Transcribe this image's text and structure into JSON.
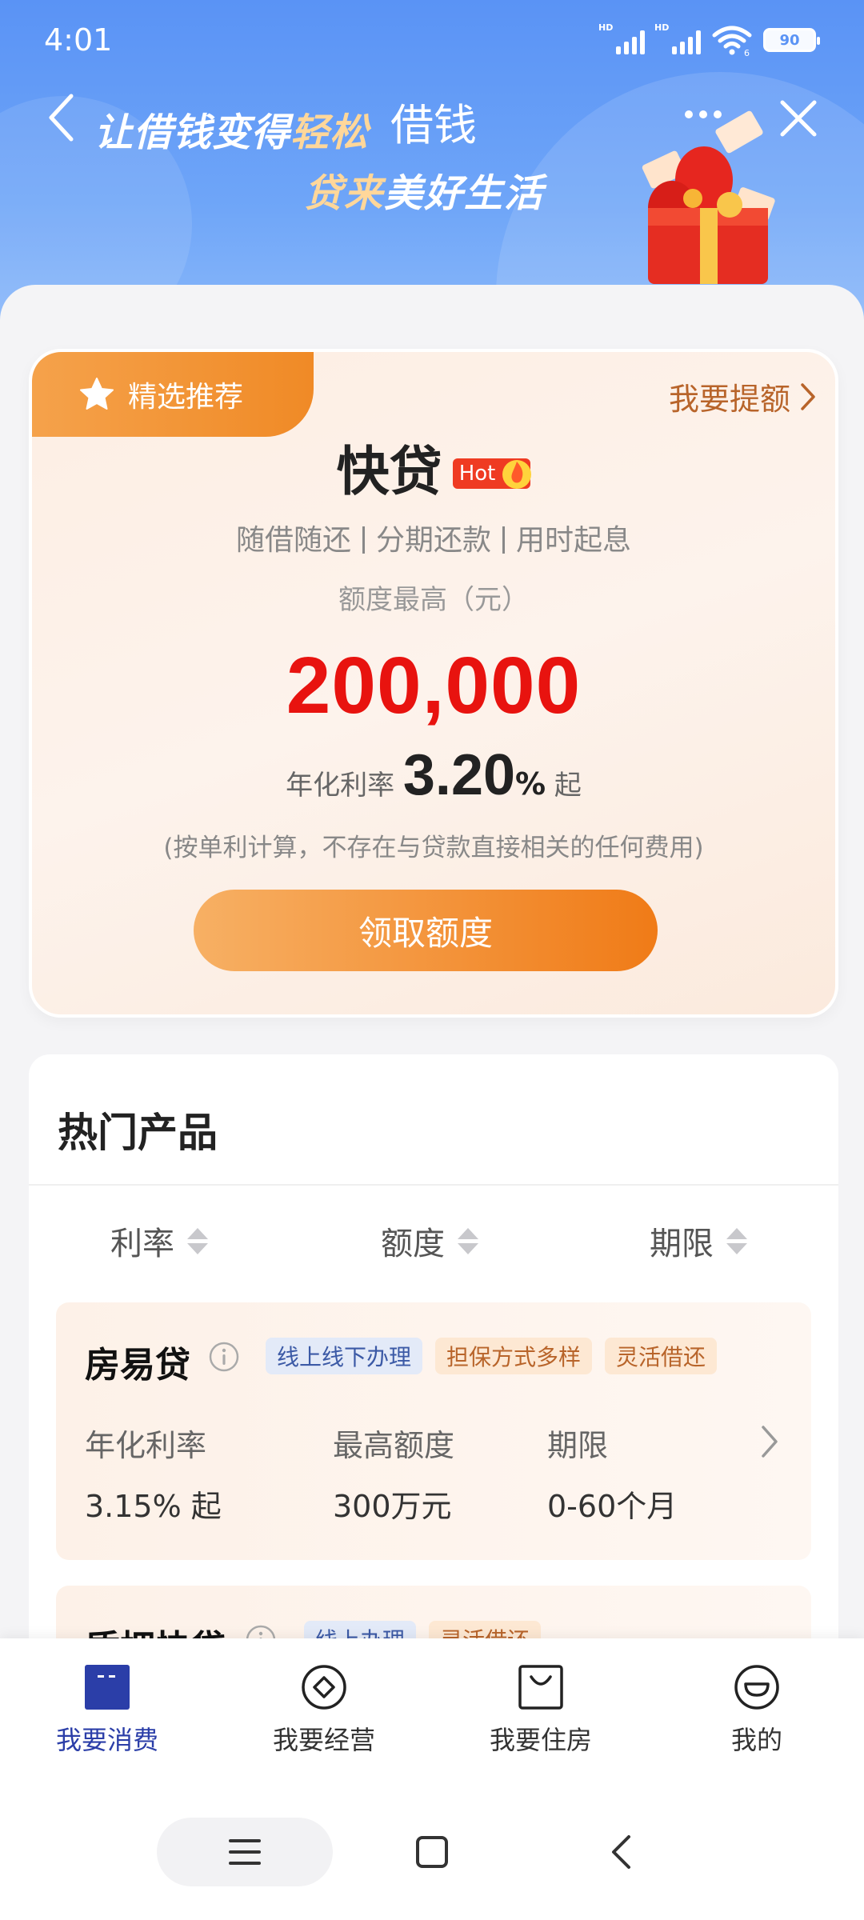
{
  "status_bar": {
    "time": "4:01",
    "network1": "HD",
    "network2": "HD",
    "wifi_sub": "6",
    "battery": "90"
  },
  "header": {
    "slogan1_part1": "让借钱变得",
    "slogan1_highlight": "轻松",
    "title": "借钱",
    "slogan2_highlight": "贷来",
    "slogan2_part2": "美好生活"
  },
  "loan_card": {
    "badge": "精选推荐",
    "withdraw_link": "我要提额",
    "product_name": "快贷",
    "hot_tag": "Hot",
    "features": [
      "随借随还",
      "分期还款",
      "用时起息"
    ],
    "limit_label": "额度最高（元）",
    "limit_amount": "200,000",
    "rate_label": "年化利率",
    "rate_value": "3.20",
    "rate_unit": "%",
    "rate_suffix": "起",
    "note": "(按单利计算，不存在与贷款直接相关的任何费用)",
    "cta": "领取额度"
  },
  "hot_products": {
    "title": "热门产品",
    "sort_options": [
      "利率",
      "额度",
      "期限"
    ],
    "products": [
      {
        "name": "房易贷",
        "tags": [
          "线上线下办理",
          "担保方式多样",
          "灵活借还"
        ],
        "metrics": [
          {
            "label": "年化利率",
            "value": "3.15% 起"
          },
          {
            "label": "最高额度",
            "value": "300万元"
          },
          {
            "label": "期限",
            "value": "0-60个月"
          }
        ]
      },
      {
        "name": "质押快贷",
        "tags": [
          "线上办理",
          "灵活借还"
        ]
      }
    ]
  },
  "bottom_nav": {
    "items": [
      {
        "label": "我要消费",
        "icon": "wallet-icon",
        "active": true
      },
      {
        "label": "我要经营",
        "icon": "diamond-icon",
        "active": false
      },
      {
        "label": "我要住房",
        "icon": "bag-icon",
        "active": false
      },
      {
        "label": "我的",
        "icon": "profile-icon",
        "active": false
      }
    ]
  },
  "colors": {
    "brand_blue": "#5a93f5",
    "accent_orange": "#f08a26",
    "amount_red": "#e8130f",
    "nav_active": "#2b3ea8"
  }
}
